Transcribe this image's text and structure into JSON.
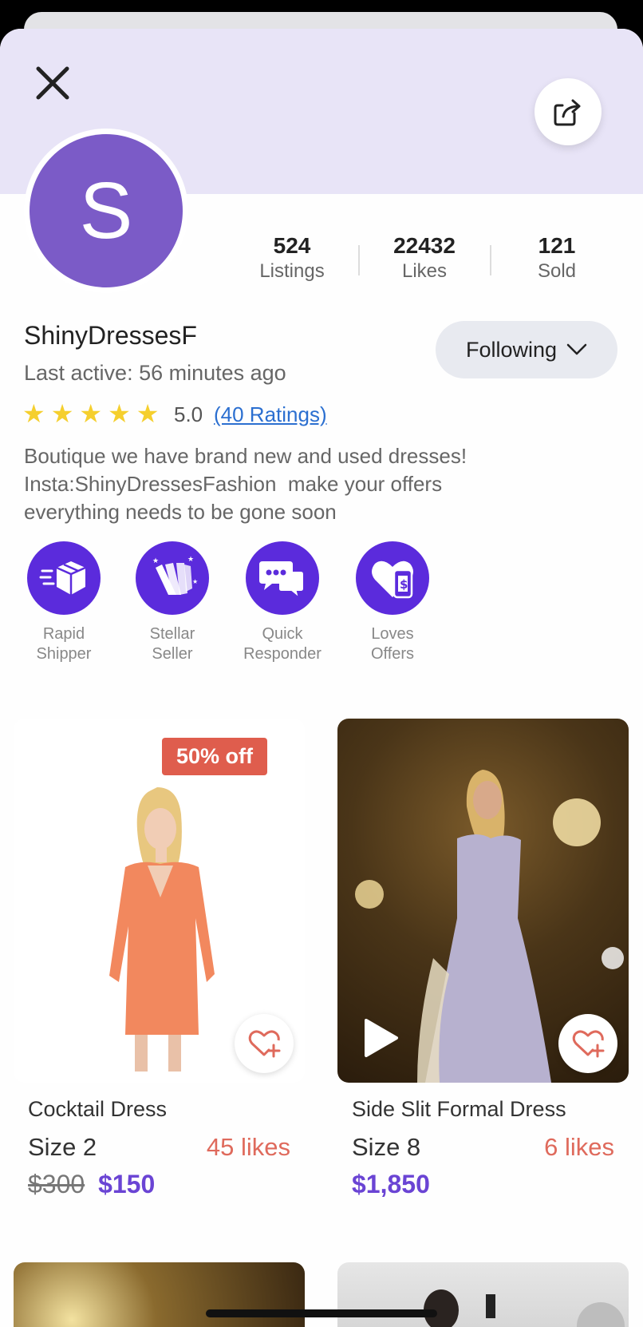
{
  "profile": {
    "name": "ShinyDressesF",
    "avatar_initial": "S",
    "last_active": "Last active: 56 minutes ago",
    "follow_label": "Following",
    "rating_value": "5.0",
    "rating_link": "(40 Ratings)",
    "star_count": 5,
    "bio_lines": [
      "Boutique we have brand new and used dresses!",
      "Insta:ShinyDressesFashion  make your offers",
      "everything needs to be gone soon"
    ]
  },
  "stats": [
    {
      "value": "524",
      "label": "Listings"
    },
    {
      "value": "22432",
      "label": "Likes"
    },
    {
      "value": "121",
      "label": "Sold"
    }
  ],
  "badges": [
    {
      "line1": "Rapid",
      "line2": "Shipper",
      "icon": "box-icon"
    },
    {
      "line1": "Stellar",
      "line2": "Seller",
      "icon": "shopping-bags-icon"
    },
    {
      "line1": "Quick",
      "line2": "Responder",
      "icon": "chat-bubbles-icon"
    },
    {
      "line1": "Loves",
      "line2": "Offers",
      "icon": "heart-phone-icon"
    }
  ],
  "listings": [
    {
      "title": "Cocktail Dress",
      "size": "Size 2",
      "likes": "45 likes",
      "original_price": "$300",
      "price": "$150",
      "discount": "50% off",
      "has_video": false
    },
    {
      "title": "Side Slit Formal Dress",
      "size": "Size 8",
      "likes": "6 likes",
      "original_price": "",
      "price": "$1,850",
      "discount": "",
      "has_video": true
    }
  ],
  "colors": {
    "accent": "#6a44d4",
    "badge": "#5b2bdc",
    "banner": "#e8e4f7",
    "likes": "#df6a5c",
    "discount": "#df5d4d",
    "star": "#f5cf2e",
    "link": "#2b6fd0"
  }
}
